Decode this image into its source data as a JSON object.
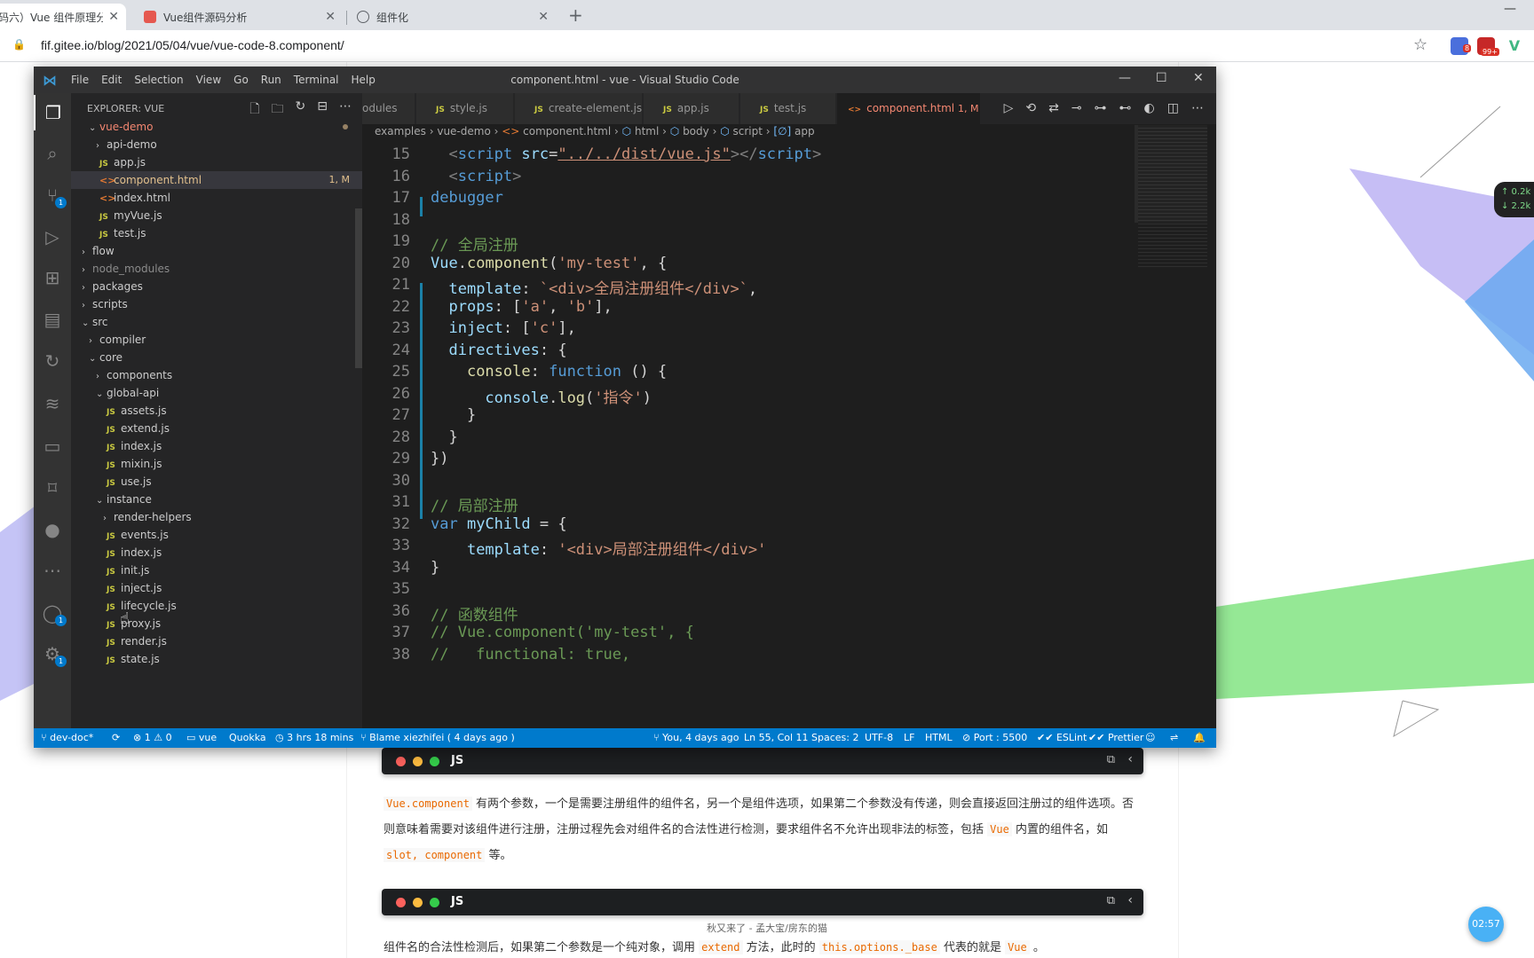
{
  "browser": {
    "tabs": [
      {
        "title": "码六）Vue 组件原理分析",
        "active": true
      },
      {
        "title": "Vue组件源码分析",
        "active": false
      },
      {
        "title": "组件化",
        "active": false
      }
    ],
    "url": "fif.gitee.io/blog/2021/05/04/vue/vue-code-8.component/",
    "ext_badges": [
      "8",
      "99+"
    ]
  },
  "vscode": {
    "menu": [
      "File",
      "Edit",
      "Selection",
      "View",
      "Go",
      "Run",
      "Terminal",
      "Help"
    ],
    "window_title": "component.html - vue - Visual Studio Code",
    "explorer_title": "EXPLORER: VUE",
    "activity_badges": {
      "scm": "1",
      "accounts": "1",
      "settings": "1"
    },
    "tree": [
      {
        "label": "vue-demo",
        "indent": 1,
        "type": "folder-open",
        "cls": "red",
        "dot": true
      },
      {
        "label": "api-demo",
        "indent": 2,
        "type": "folder"
      },
      {
        "label": "app.js",
        "indent": 2,
        "type": "js"
      },
      {
        "label": "component.html",
        "indent": 2,
        "type": "html",
        "cls": "mod",
        "badge": "1, M",
        "selected": true
      },
      {
        "label": "index.html",
        "indent": 2,
        "type": "html"
      },
      {
        "label": "myVue.js",
        "indent": 2,
        "type": "js"
      },
      {
        "label": "test.js",
        "indent": 2,
        "type": "js"
      },
      {
        "label": "flow",
        "indent": 0,
        "type": "folder"
      },
      {
        "label": "node_modules",
        "indent": 0,
        "type": "folder",
        "cls": "dim"
      },
      {
        "label": "packages",
        "indent": 0,
        "type": "folder"
      },
      {
        "label": "scripts",
        "indent": 0,
        "type": "folder"
      },
      {
        "label": "src",
        "indent": 0,
        "type": "folder-open"
      },
      {
        "label": "compiler",
        "indent": 1,
        "type": "folder"
      },
      {
        "label": "core",
        "indent": 1,
        "type": "folder-open"
      },
      {
        "label": "components",
        "indent": 2,
        "type": "folder"
      },
      {
        "label": "global-api",
        "indent": 2,
        "type": "folder-open"
      },
      {
        "label": "assets.js",
        "indent": 3,
        "type": "js"
      },
      {
        "label": "extend.js",
        "indent": 3,
        "type": "js"
      },
      {
        "label": "index.js",
        "indent": 3,
        "type": "js"
      },
      {
        "label": "mixin.js",
        "indent": 3,
        "type": "js"
      },
      {
        "label": "use.js",
        "indent": 3,
        "type": "js"
      },
      {
        "label": "instance",
        "indent": 2,
        "type": "folder-open"
      },
      {
        "label": "render-helpers",
        "indent": 3,
        "type": "folder"
      },
      {
        "label": "events.js",
        "indent": 3,
        "type": "js"
      },
      {
        "label": "index.js",
        "indent": 3,
        "type": "js"
      },
      {
        "label": "init.js",
        "indent": 3,
        "type": "js"
      },
      {
        "label": "inject.js",
        "indent": 3,
        "type": "js"
      },
      {
        "label": "lifecycle.js",
        "indent": 3,
        "type": "js"
      },
      {
        "label": "proxy.js",
        "indent": 3,
        "type": "js"
      },
      {
        "label": "render.js",
        "indent": 3,
        "type": "js"
      },
      {
        "label": "state.js",
        "indent": 3,
        "type": "js"
      }
    ],
    "editor_tabs": [
      {
        "label": "odules",
        "icon": ""
      },
      {
        "label": "style.js",
        "icon": "JS"
      },
      {
        "label": "create-element.js",
        "icon": "JS"
      },
      {
        "label": "app.js",
        "icon": "JS"
      },
      {
        "label": "test.js",
        "icon": "JS"
      },
      {
        "label": "component.html",
        "icon": "<>",
        "suffix": "1, M",
        "active": true
      }
    ],
    "breadcrumb": [
      "examples",
      "vue-demo",
      "component.html",
      "html",
      "body",
      "script",
      "app"
    ],
    "code_lines": [
      {
        "n": "15",
        "html": "  <span class=\"punct\">&lt;</span><span class=\"tag\">script</span> <span class=\"attr\">src</span>=<span class=\"str link\">\"../../dist/vue.js\"</span><span class=\"punct\">&gt;&lt;/</span><span class=\"tag\">script</span><span class=\"punct\">&gt;</span>"
      },
      {
        "n": "16",
        "html": "  <span class=\"punct\">&lt;</span><span class=\"tag\">script</span><span class=\"punct\">&gt;</span>"
      },
      {
        "n": "17",
        "html": "<span class=\"kw\">debugger</span>"
      },
      {
        "n": "18",
        "html": ""
      },
      {
        "n": "19",
        "html": "<span class=\"comment\">// 全局注册</span>"
      },
      {
        "n": "20",
        "html": "<span class=\"var\">Vue</span>.<span class=\"fn\">component</span>(<span class=\"str\">'my-test'</span>, {"
      },
      {
        "n": "21",
        "html": "  <span class=\"var\">template</span>: <span class=\"str\">`&lt;div&gt;全局注册组件&lt;/div&gt;`</span>,"
      },
      {
        "n": "22",
        "html": "  <span class=\"var\">props</span>: [<span class=\"str\">'a'</span>, <span class=\"str\">'b'</span>],"
      },
      {
        "n": "23",
        "html": "  <span class=\"var\">inject</span>: [<span class=\"str\">'c'</span>],"
      },
      {
        "n": "24",
        "html": "  <span class=\"var\">directives</span>: {"
      },
      {
        "n": "25",
        "html": "    <span class=\"fn\">console</span>: <span class=\"kw\">function</span> () {"
      },
      {
        "n": "26",
        "html": "      <span class=\"var\">console</span>.<span class=\"fn\">log</span>(<span class=\"str\">'指令'</span>)"
      },
      {
        "n": "27",
        "html": "    }"
      },
      {
        "n": "28",
        "html": "  }"
      },
      {
        "n": "29",
        "html": "})"
      },
      {
        "n": "30",
        "html": ""
      },
      {
        "n": "31",
        "html": "<span class=\"comment\">// 局部注册</span>"
      },
      {
        "n": "32",
        "html": "<span class=\"kw\">var</span> <span class=\"var\">myChild</span> = {"
      },
      {
        "n": "33",
        "html": "    <span class=\"var\">template</span>: <span class=\"str\">'&lt;div&gt;局部注册组件&lt;/div&gt;'</span>"
      },
      {
        "n": "34",
        "html": "}"
      },
      {
        "n": "35",
        "html": ""
      },
      {
        "n": "36",
        "html": "<span class=\"comment\">// 函数组件</span>"
      },
      {
        "n": "37",
        "html": "<span class=\"comment\">// Vue.component('my-test', {</span>"
      },
      {
        "n": "38",
        "html": "<span class=\"comment\">//   functional: true,</span>"
      }
    ],
    "status_left": [
      "dev-doc*",
      "⟳",
      "⊗ 1 ⚠ 0",
      "vue",
      "Quokka",
      "3 hrs 18 mins",
      "Blame xiezhifei ( 4 days ago )"
    ],
    "status_right": [
      "You, 4 days ago",
      "Ln 55, Col 11",
      "Spaces: 2",
      "UTF-8",
      "LF",
      "HTML",
      "Port : 5500",
      "ESLint",
      "Prettier"
    ]
  },
  "article": {
    "lang_label": "JS",
    "para1_parts": [
      "Vue.component",
      " 有两个参数，一个是需要注册组件的组件名，另一个是组件选项，如果第二个参数没有传递，则会直接返回注册过的组件选项。否则意味着需要对该组件进行注册，注册过程先会对组件名的合法性进行检测，要求组件名不允许出现非法的标签，包括 ",
      "Vue",
      " 内置的组件名，如 ",
      "slot, component",
      " 等。"
    ],
    "para2_parts": [
      "组件名的合法性检测后，如果第二个参数是一个纯对象，调用 ",
      "extend",
      " 方法，此时的 ",
      "this.options._base",
      " 代表的就是 ",
      "Vue",
      " 。"
    ],
    "song": "秋又来了 - 孟大宝/房东的猫",
    "timer": "02:57",
    "netspeed_up": "↑ 0.2k",
    "netspeed_down": "↓ 2.2k"
  }
}
